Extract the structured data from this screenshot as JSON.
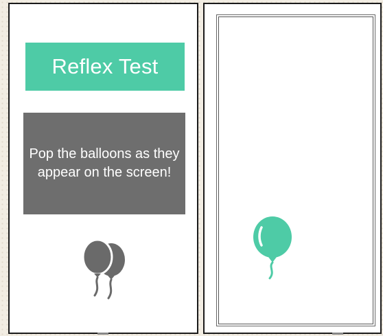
{
  "left_screen": {
    "title": "Reflex Test",
    "instruction": "Pop the balloons as they appear on the screen!",
    "icon": "balloons-icon"
  },
  "right_screen": {
    "target_icon": "balloon-icon"
  },
  "colors": {
    "accent": "#4ecba6",
    "panel_gray": "#6e6e6e",
    "icon_gray": "#6a6a6a",
    "background": "#ffffff"
  }
}
